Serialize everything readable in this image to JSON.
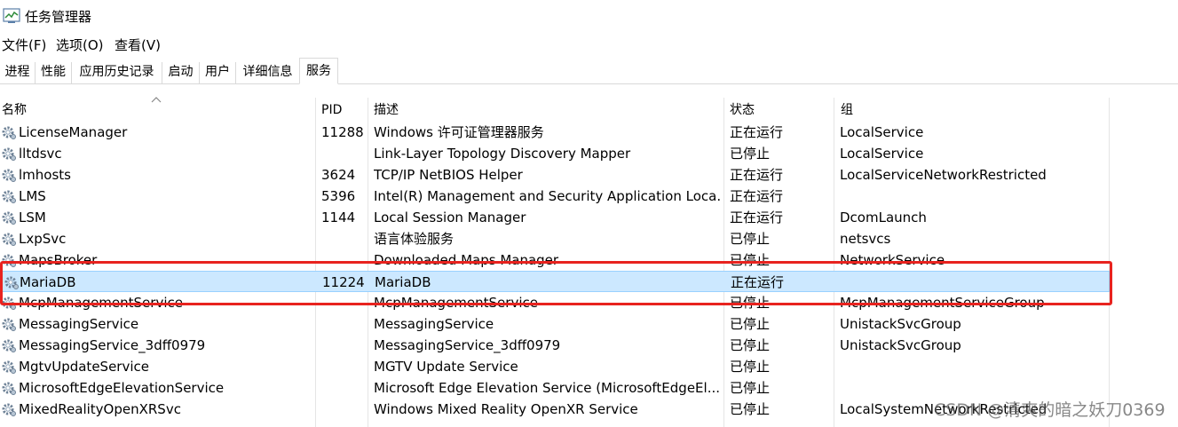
{
  "window": {
    "title": "任务管理器",
    "icon": "task-manager-icon"
  },
  "menu": [
    {
      "label": "文件(F)"
    },
    {
      "label": "选项(O)"
    },
    {
      "label": "查看(V)"
    }
  ],
  "tabs": [
    {
      "label": "进程"
    },
    {
      "label": "性能"
    },
    {
      "label": "应用历史记录"
    },
    {
      "label": "启动"
    },
    {
      "label": "用户"
    },
    {
      "label": "详细信息"
    },
    {
      "label": "服务",
      "active": true
    }
  ],
  "columns": {
    "name": "名称",
    "pid": "PID",
    "desc": "描述",
    "status": "状态",
    "group": "组"
  },
  "rows": [
    {
      "name": "LicenseManager",
      "pid": "11288",
      "desc": "Windows 许可证管理器服务",
      "status": "正在运行",
      "group": "LocalService"
    },
    {
      "name": "lltdsvc",
      "pid": "",
      "desc": "Link-Layer Topology Discovery Mapper",
      "status": "已停止",
      "group": "LocalService"
    },
    {
      "name": "lmhosts",
      "pid": "3624",
      "desc": "TCP/IP NetBIOS Helper",
      "status": "正在运行",
      "group": "LocalServiceNetworkRestricted"
    },
    {
      "name": "LMS",
      "pid": "5396",
      "desc": "Intel(R) Management and Security Application Loca...",
      "status": "正在运行",
      "group": ""
    },
    {
      "name": "LSM",
      "pid": "1144",
      "desc": "Local Session Manager",
      "status": "正在运行",
      "group": "DcomLaunch"
    },
    {
      "name": "LxpSvc",
      "pid": "",
      "desc": "语言体验服务",
      "status": "已停止",
      "group": "netsvcs"
    },
    {
      "name": "MapsBroker",
      "pid": "",
      "desc": "Downloaded Maps Manager",
      "status": "已停止",
      "group": "NetworkService"
    },
    {
      "name": "MariaDB",
      "pid": "11224",
      "desc": "MariaDB",
      "status": "正在运行",
      "group": "",
      "selected": true
    },
    {
      "name": "McpManagementService",
      "pid": "",
      "desc": "McpManagementService",
      "status": "已停止",
      "group": "McpManagementServiceGroup"
    },
    {
      "name": "MessagingService",
      "pid": "",
      "desc": "MessagingService",
      "status": "已停止",
      "group": "UnistackSvcGroup"
    },
    {
      "name": "MessagingService_3dff0979",
      "pid": "",
      "desc": "MessagingService_3dff0979",
      "status": "已停止",
      "group": "UnistackSvcGroup"
    },
    {
      "name": "MgtvUpdateService",
      "pid": "",
      "desc": "MGTV Update Service",
      "status": "已停止",
      "group": ""
    },
    {
      "name": "MicrosoftEdgeElevationService",
      "pid": "",
      "desc": "Microsoft Edge Elevation Service (MicrosoftEdgeEl...",
      "status": "已停止",
      "group": ""
    },
    {
      "name": "MixedRealityOpenXRSvc",
      "pid": "",
      "desc": "Windows Mixed Reality OpenXR Service",
      "status": "已停止",
      "group": "LocalSystemNetworkRestricted"
    }
  ],
  "watermark": "CSDN @清爽的暗之妖刀0369",
  "colors": {
    "selection": "#cce8ff",
    "selection_border": "#99d1ff",
    "annotation": "#e8231f"
  }
}
